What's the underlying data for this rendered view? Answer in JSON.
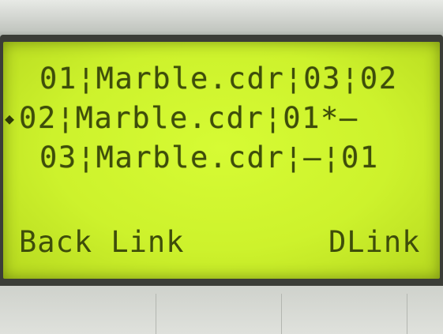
{
  "lcd": {
    "rows": [
      {
        "text": "01¦Marble.cdr¦03¦02"
      },
      {
        "text": "02¦Marble.cdr¦01*—"
      },
      {
        "text": "03¦Marble.cdr¦—¦01"
      }
    ],
    "cursor": "◆",
    "softkeys": {
      "left": "Back Link",
      "right": "DLink"
    }
  }
}
